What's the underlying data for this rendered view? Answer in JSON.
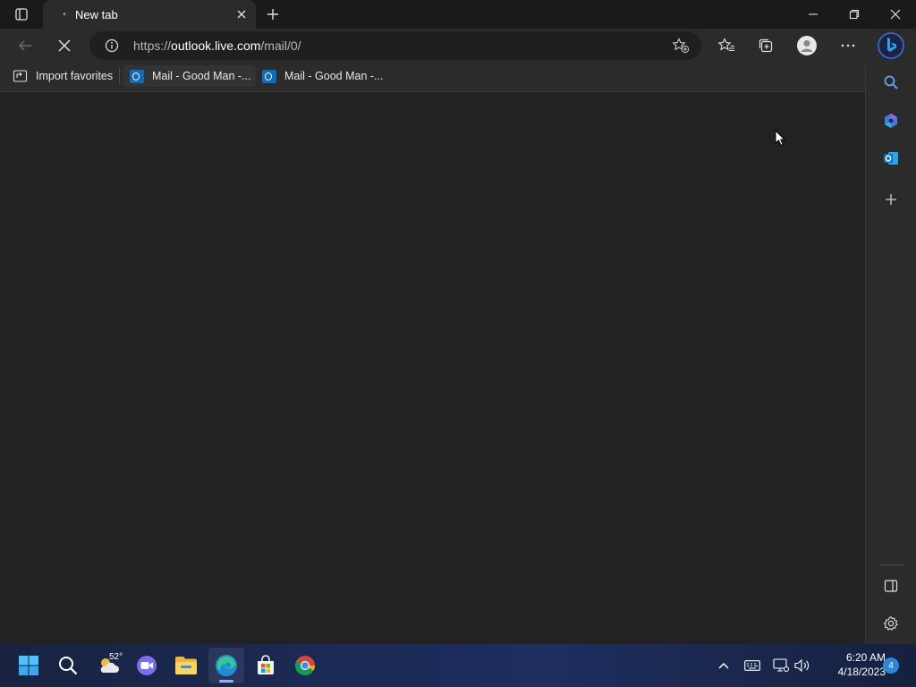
{
  "browser": {
    "tab": {
      "title": "New tab"
    },
    "address": {
      "prefix": "https://",
      "host": "outlook.live.com",
      "path": "/mail/0/"
    },
    "favorites": [
      {
        "label": "Import favorites"
      },
      {
        "label": "Mail - Good Man -..."
      },
      {
        "label": "Mail - Good Man -..."
      }
    ]
  },
  "taskbar": {
    "weather_temp": "52°",
    "time": "6:20 AM",
    "date": "4/18/2023",
    "notification_count": "4"
  },
  "colors": {
    "accent": "#0f6cbd",
    "taskbar": "#1b2a55"
  }
}
